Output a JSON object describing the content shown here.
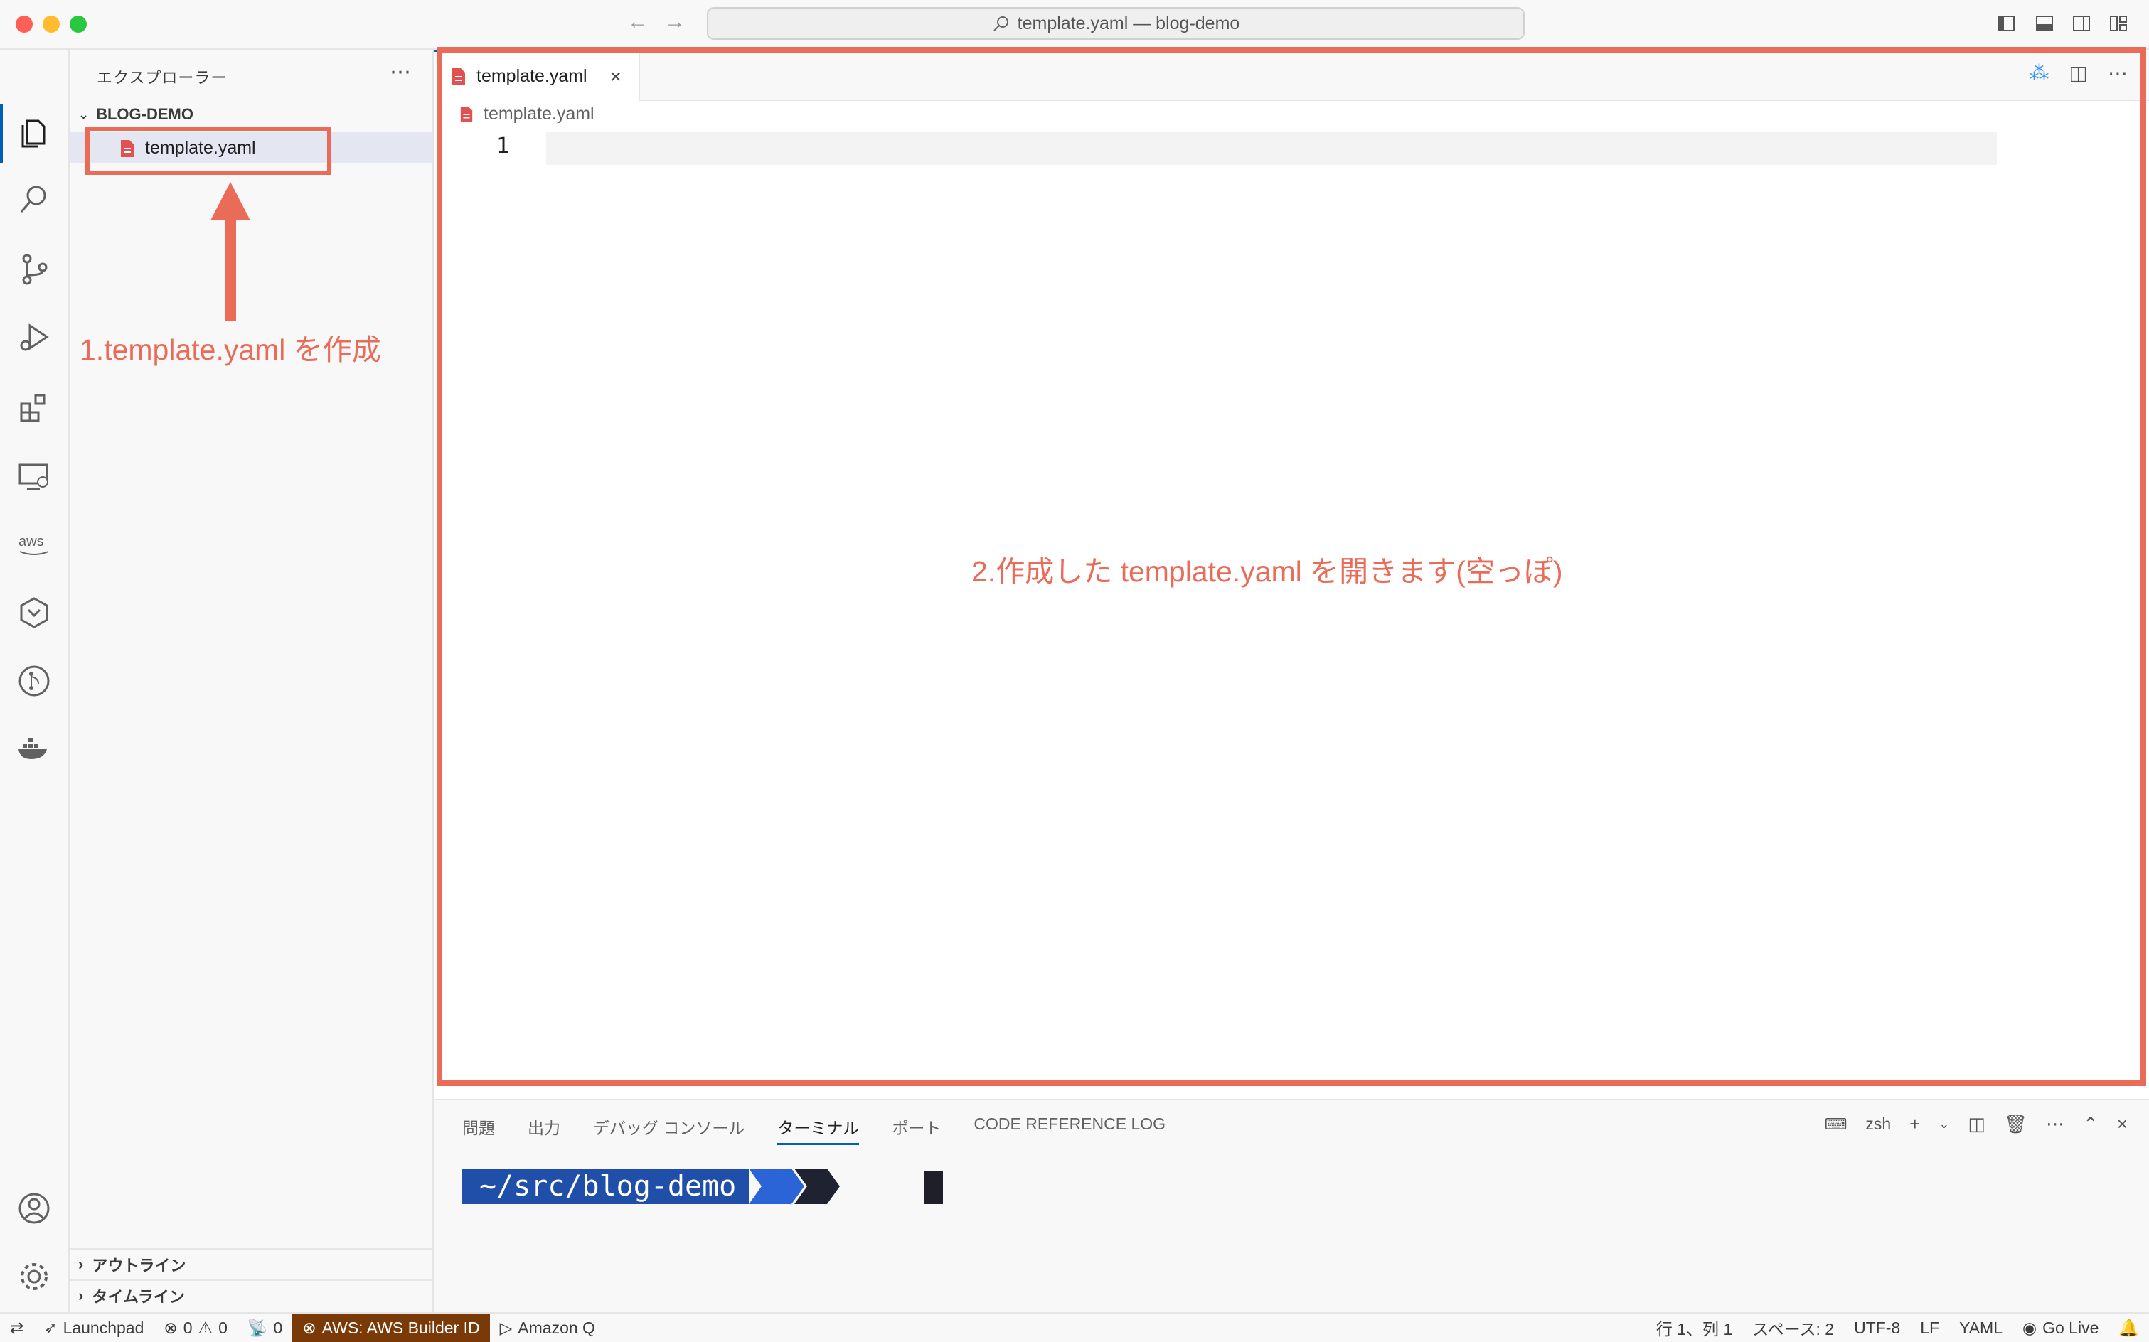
{
  "window": {
    "title": "template.yaml — blog-demo"
  },
  "sidebar": {
    "title": "エクスプローラー",
    "folder": "BLOG-DEMO",
    "files": [
      {
        "name": "template.yaml"
      }
    ],
    "sections": [
      "アウトライン",
      "タイムライン"
    ]
  },
  "editor": {
    "tab_label": "template.yaml",
    "breadcrumb": "template.yaml",
    "line_number": "1"
  },
  "annotations": {
    "step1": "1.template.yaml を作成",
    "step2": "2.作成した template.yaml を開きます(空っぽ)",
    "color": "#ea6b58"
  },
  "panel": {
    "tabs": [
      "問題",
      "出力",
      "デバッグ コンソール",
      "ターミナル",
      "ポート",
      "CODE REFERENCE LOG"
    ],
    "active_tab": "ターミナル",
    "shell": "zsh",
    "prompt_path": "~/src/blog-demo"
  },
  "statusbar": {
    "launchpad": "Launchpad",
    "errors": "0",
    "warnings": "0",
    "ports": "0",
    "aws": "AWS: AWS Builder ID",
    "amazon_q": "Amazon Q",
    "position": "行 1、列 1",
    "spaces": "スペース: 2",
    "encoding": "UTF-8",
    "eol": "LF",
    "language": "YAML",
    "golive": "Go Live"
  }
}
